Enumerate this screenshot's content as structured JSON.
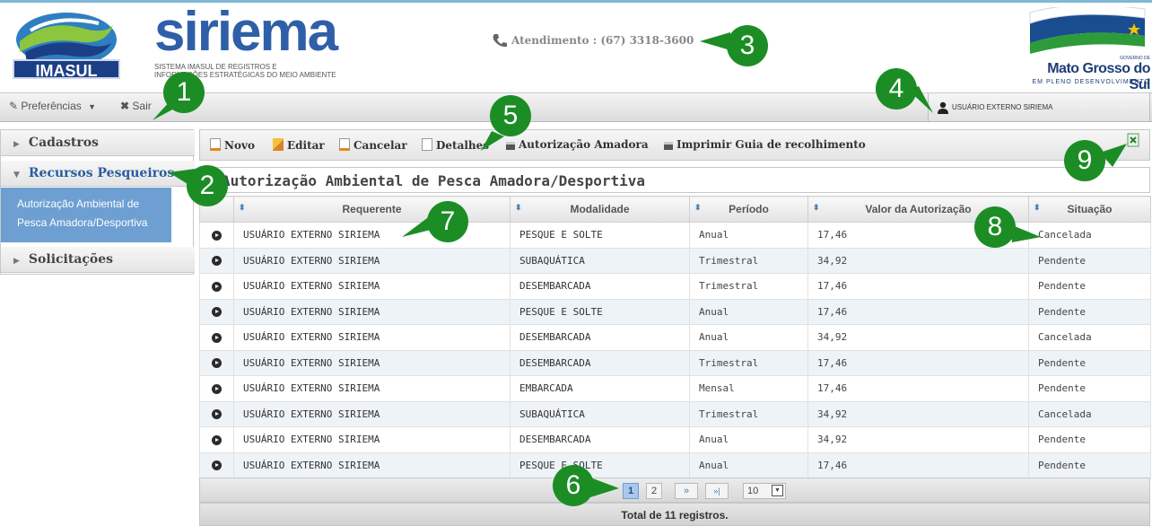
{
  "header": {
    "imasul_label": "IMASUL",
    "title": "siriema",
    "subtitle_line1": "SISTEMA IMASUL DE REGISTROS E",
    "subtitle_line2": "INFORMAÇÕES ESTRATÉGICAS DO MEIO AMBIENTE",
    "atendimento": "Atendimento : (67) 3318-3600",
    "gov_small": "GOVERNO DE",
    "gov_name": "Mato Grosso do Sul",
    "gov_slogan": "EM PLENO DESENVOLVIMENTO"
  },
  "topbar": {
    "preferencias": "Preferências",
    "sair": "Sair",
    "user": "USUÁRIO EXTERNO SIRIEMA"
  },
  "sidebar": {
    "cadastros": "Cadastros",
    "recursos": "Recursos Pesqueiros",
    "active_item_line1": "Autorização Ambiental de",
    "active_item_line2": "Pesca Amadora/Desportiva",
    "solicitacoes": "Solicitações"
  },
  "toolbar": {
    "novo": "Novo",
    "editar": "Editar",
    "cancelar": "Cancelar",
    "detalhes": "Detalhes",
    "autorizacao": "Autorização Amadora",
    "imprimir": "Imprimir Guia de recolhimento"
  },
  "panel_title": "Autorização Ambiental de Pesca Amadora/Desportiva",
  "table": {
    "columns": [
      "Requerente",
      "Modalidade",
      "Período",
      "Valor da Autorização",
      "Situação"
    ],
    "rows": [
      [
        "USUÁRIO EXTERNO SIRIEMA",
        "PESQUE E SOLTE",
        "Anual",
        "17,46",
        "Cancelada"
      ],
      [
        "USUÁRIO EXTERNO SIRIEMA",
        "SUBAQUÁTICA",
        "Trimestral",
        "34,92",
        "Pendente"
      ],
      [
        "USUÁRIO EXTERNO SIRIEMA",
        "DESEMBARCADA",
        "Trimestral",
        "17,46",
        "Pendente"
      ],
      [
        "USUÁRIO EXTERNO SIRIEMA",
        "PESQUE E SOLTE",
        "Anual",
        "17,46",
        "Pendente"
      ],
      [
        "USUÁRIO EXTERNO SIRIEMA",
        "DESEMBARCADA",
        "Anual",
        "34,92",
        "Cancelada"
      ],
      [
        "USUÁRIO EXTERNO SIRIEMA",
        "DESEMBARCADA",
        "Trimestral",
        "17,46",
        "Pendente"
      ],
      [
        "USUÁRIO EXTERNO SIRIEMA",
        "EMBARCADA",
        "Mensal",
        "17,46",
        "Pendente"
      ],
      [
        "USUÁRIO EXTERNO SIRIEMA",
        "SUBAQUÁTICA",
        "Trimestral",
        "34,92",
        "Cancelada"
      ],
      [
        "USUÁRIO EXTERNO SIRIEMA",
        "DESEMBARCADA",
        "Anual",
        "34,92",
        "Pendente"
      ],
      [
        "USUÁRIO EXTERNO SIRIEMA",
        "PESQUE E SOLTE",
        "Anual",
        "17,46",
        "Pendente"
      ]
    ]
  },
  "pager": {
    "pages": [
      "1",
      "2"
    ],
    "next": "»",
    "last": "»|",
    "page_size": "10",
    "total": "Total de 11 registros."
  },
  "callouts": [
    "1",
    "2",
    "3",
    "4",
    "5",
    "6",
    "7",
    "8",
    "9"
  ],
  "colors": {
    "accent": "#2f5fa8",
    "callout": "#1c8d25",
    "active": "#6d9fd2"
  }
}
